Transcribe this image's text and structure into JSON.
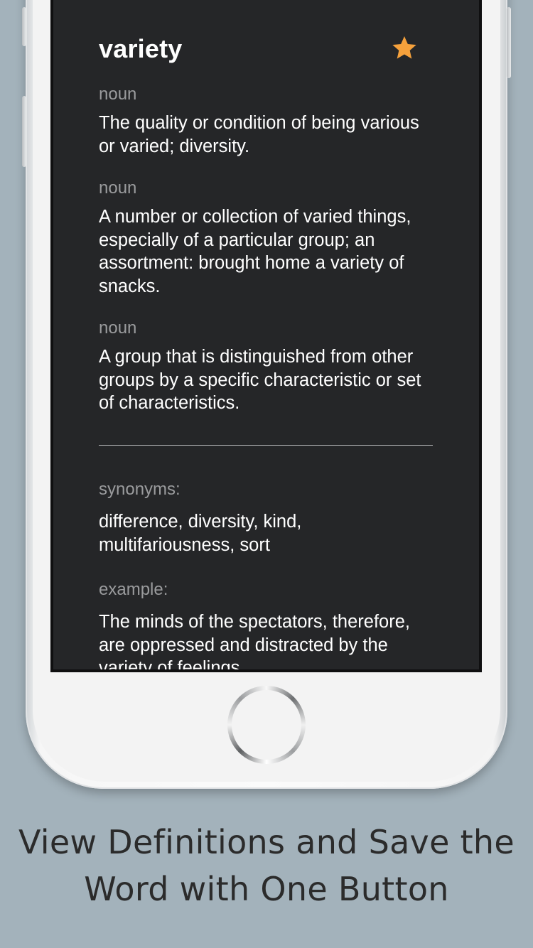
{
  "entry": {
    "word": "variety",
    "favorite": true,
    "definitions": [
      {
        "pos": "noun",
        "text": "The quality or condition of being various or varied; diversity."
      },
      {
        "pos": "noun",
        "text": "A number or collection of varied things, especially of a particular group; an assortment: brought home a variety of snacks."
      },
      {
        "pos": "noun",
        "text": "A group that is distinguished from other groups by a specific characteristic or set of characteristics."
      }
    ],
    "synonyms_label": "synonyms:",
    "synonyms": "difference, diversity, kind, multifariousness, sort",
    "example_label": "example:",
    "example": "The minds of the spectators, therefore, are oppressed and distracted by the variety of feelings"
  },
  "icons": {
    "favorite": "star-icon",
    "home": "home-button"
  },
  "colors": {
    "background": "#a3b2bb",
    "screen": "#252628",
    "star": "#f5a13c",
    "secondary_text": "#9a9b9d"
  },
  "caption": {
    "line1": "View Definitions and Save the",
    "line2": "Word with One Button"
  }
}
